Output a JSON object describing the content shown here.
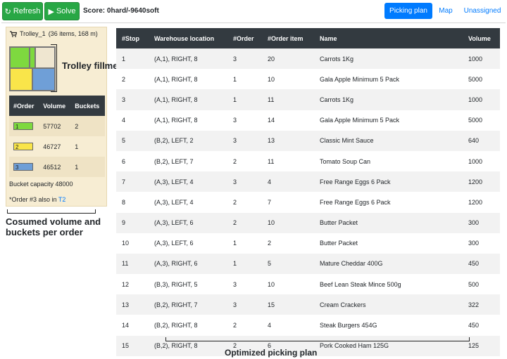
{
  "toolbar": {
    "refresh_label": "Refresh",
    "solve_label": "Solve",
    "score_text": "Score: 0hard/-9640soft"
  },
  "nav": {
    "picking_plan": "Picking plan",
    "map": "Map",
    "unassigned": "Unassigned"
  },
  "trolley": {
    "title": "Trolley_1",
    "summary": "(36 items, 168 m)",
    "headers": [
      "#Order",
      "Volume",
      "Buckets"
    ],
    "orders": [
      {
        "id": "1",
        "color": "#7ed93f",
        "volume": "57702",
        "buckets": "2"
      },
      {
        "id": "2",
        "color": "#f9e54a",
        "volume": "46727",
        "buckets": "1"
      },
      {
        "id": "3",
        "color": "#6f9fd7",
        "volume": "46512",
        "buckets": "1"
      }
    ],
    "capacity_text": "Bucket capacity 48000",
    "note_prefix": "*Order #3 also in ",
    "note_link": "T2"
  },
  "annotations": {
    "fill": "Trolley fillment",
    "volume_line1": "Cosumed volume and",
    "volume_line2": "buckets per order",
    "plan": "Optimized picking plan"
  },
  "plan": {
    "headers": [
      "#Stop",
      "Warehouse location",
      "#Order",
      "#Order item",
      "Name",
      "Volume"
    ],
    "rows": [
      [
        "1",
        "(A,1), RIGHT, 8",
        "3",
        "20",
        "Carrots 1Kg",
        "1000"
      ],
      [
        "2",
        "(A,1), RIGHT, 8",
        "1",
        "10",
        "Gala Apple Minimum 5 Pack",
        "5000"
      ],
      [
        "3",
        "(A,1), RIGHT, 8",
        "1",
        "11",
        "Carrots 1Kg",
        "1000"
      ],
      [
        "4",
        "(A,1), RIGHT, 8",
        "3",
        "14",
        "Gala Apple Minimum 5 Pack",
        "5000"
      ],
      [
        "5",
        "(B,2), LEFT, 2",
        "3",
        "13",
        "Classic Mint Sauce",
        "640"
      ],
      [
        "6",
        "(B,2), LEFT, 7",
        "2",
        "11",
        "Tomato Soup Can",
        "1000"
      ],
      [
        "7",
        "(A,3), LEFT, 4",
        "3",
        "4",
        "Free Range Eggs 6 Pack",
        "1200"
      ],
      [
        "8",
        "(A,3), LEFT, 4",
        "2",
        "7",
        "Free Range Eggs 6 Pack",
        "1200"
      ],
      [
        "9",
        "(A,3), LEFT, 6",
        "2",
        "10",
        "Butter Packet",
        "300"
      ],
      [
        "10",
        "(A,3), LEFT, 6",
        "1",
        "2",
        "Butter Packet",
        "300"
      ],
      [
        "11",
        "(A,3), RIGHT, 6",
        "1",
        "5",
        "Mature Cheddar 400G",
        "450"
      ],
      [
        "12",
        "(B,3), RIGHT, 5",
        "3",
        "10",
        "Beef Lean Steak Mince 500g",
        "500"
      ],
      [
        "13",
        "(B,2), RIGHT, 7",
        "3",
        "15",
        "Cream Crackers",
        "322"
      ],
      [
        "14",
        "(B,2), RIGHT, 8",
        "2",
        "4",
        "Steak Burgers 454G",
        "450"
      ],
      [
        "15",
        "(B,2), RIGHT, 8",
        "2",
        "6",
        "Pork Cooked Ham 125G",
        "125"
      ]
    ]
  }
}
